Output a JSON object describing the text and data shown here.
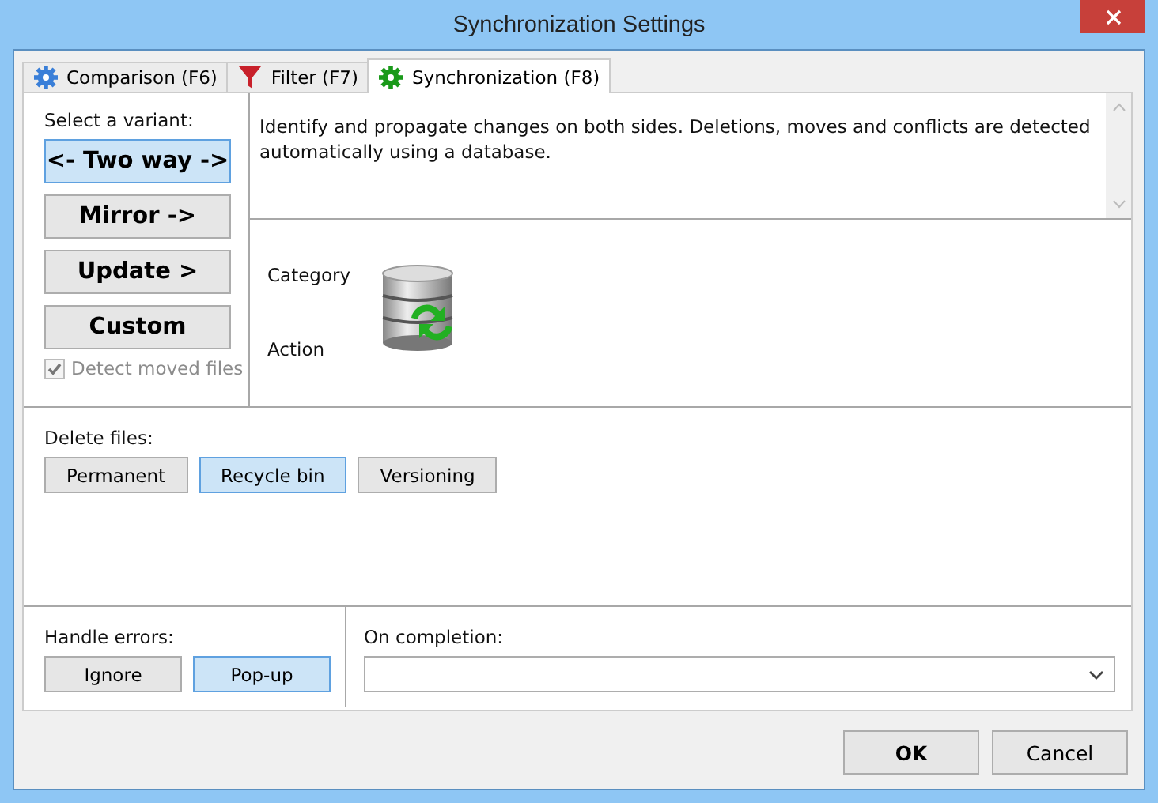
{
  "window": {
    "title": "Synchronization Settings"
  },
  "tabs": [
    {
      "label": "Comparison (F6)",
      "kind": "gear",
      "selected": false
    },
    {
      "label": "Filter (F7)",
      "kind": "funnel",
      "selected": false
    },
    {
      "label": "Synchronization (F8)",
      "kind": "gear",
      "selected": true
    }
  ],
  "variant": {
    "label": "Select a variant:",
    "options": [
      {
        "label": "<- Two way ->",
        "selected": true
      },
      {
        "label": "Mirror ->",
        "selected": false
      },
      {
        "label": "Update >",
        "selected": false
      },
      {
        "label": "Custom",
        "selected": false
      }
    ],
    "detect_moved": {
      "label": "Detect moved files",
      "checked": true,
      "disabled": true
    }
  },
  "description": "Identify and propagate changes on both sides. Deletions, moves and conflicts are detected automatically using a database.",
  "category_label": "Category",
  "action_label": "Action",
  "delete_files": {
    "label": "Delete files:",
    "options": [
      {
        "label": "Permanent",
        "selected": false
      },
      {
        "label": "Recycle bin",
        "selected": true
      },
      {
        "label": "Versioning",
        "selected": false
      }
    ]
  },
  "handle_errors": {
    "label": "Handle errors:",
    "options": [
      {
        "label": "Ignore",
        "selected": false
      },
      {
        "label": "Pop-up",
        "selected": true
      }
    ]
  },
  "on_completion": {
    "label": "On completion:"
  },
  "buttons": [
    "OK",
    "Cancel"
  ]
}
